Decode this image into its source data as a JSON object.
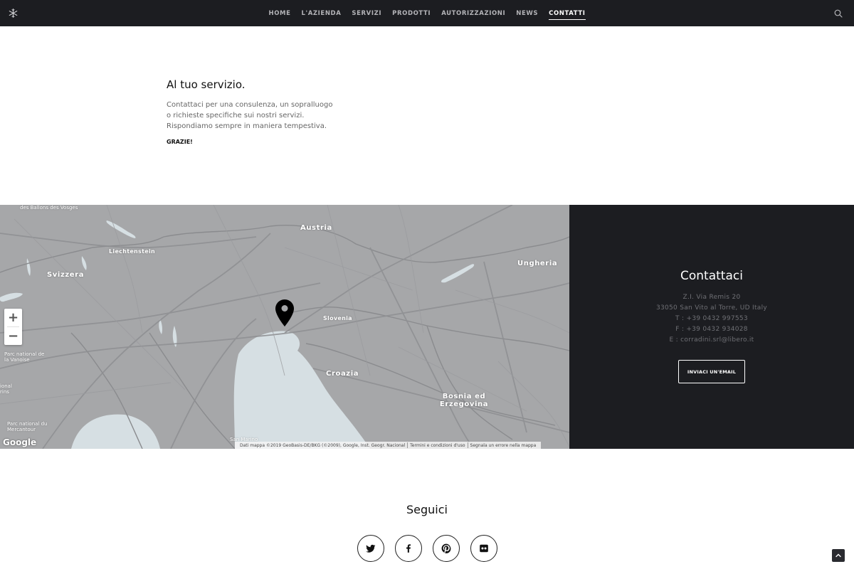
{
  "nav": {
    "items": [
      {
        "label": "HOME"
      },
      {
        "label": "L'AZIENDA"
      },
      {
        "label": "SERVIZI"
      },
      {
        "label": "PRODOTTI"
      },
      {
        "label": "AUTORIZZAZIONI"
      },
      {
        "label": "NEWS"
      },
      {
        "label": "CONTATTI",
        "active": true
      }
    ],
    "logo_icon": "snowflake-logo-icon",
    "search_icon": "search-icon"
  },
  "intro": {
    "title": "Al tuo servizio.",
    "lines": [
      "Contattaci per una consulenza, un sopralluogo",
      "o richieste specifiche sui nostri servizi.",
      "Rispondiamo sempre in maniera tempestiva."
    ],
    "thanks": "GRAZIE!"
  },
  "map": {
    "labels": {
      "austria": "Austria",
      "svizzera": "Svizzera",
      "liechtenstein": "Liechtenstein",
      "ungheria": "Ungheria",
      "slovenia": "Slovenia",
      "croazia": "Croazia",
      "bosnia": "Bosnia ed Erzegovina",
      "san_marino": "San Marino",
      "ballons": "des Ballons des Vosges",
      "vanoise": "Parc national de la Vanoise",
      "mercantour": "Parc national du Mercantour",
      "rins": "rins",
      "ional": "ional"
    },
    "zoom_in": "+",
    "zoom_out": "−",
    "google": "Google",
    "footer": {
      "data": "Dati mappa ©2019 GeoBasis-DE/BKG (©2009), Google, Inst. Geogr. Nacional",
      "terms": "Termini e condizioni d'uso",
      "report": "Segnala un errore nella mappa"
    },
    "colors": {
      "land": "#a6a7a9",
      "water": "#d6dfe3",
      "roads": "#8a8b8e"
    }
  },
  "contact": {
    "title": "Contattaci",
    "lines": [
      "Z.I. Via Remis 20",
      "33050 San Vito al Torre, UD Italy",
      "T : +39 0432 997553",
      "F : +39 0432 934028",
      "E : corradini.srl@libero.it"
    ],
    "email_button": "INVIACI UN'EMAIL"
  },
  "follow": {
    "title": "Seguici",
    "socials": [
      "twitter-icon",
      "facebook-icon",
      "pinterest-icon",
      "flickr-icon"
    ]
  }
}
